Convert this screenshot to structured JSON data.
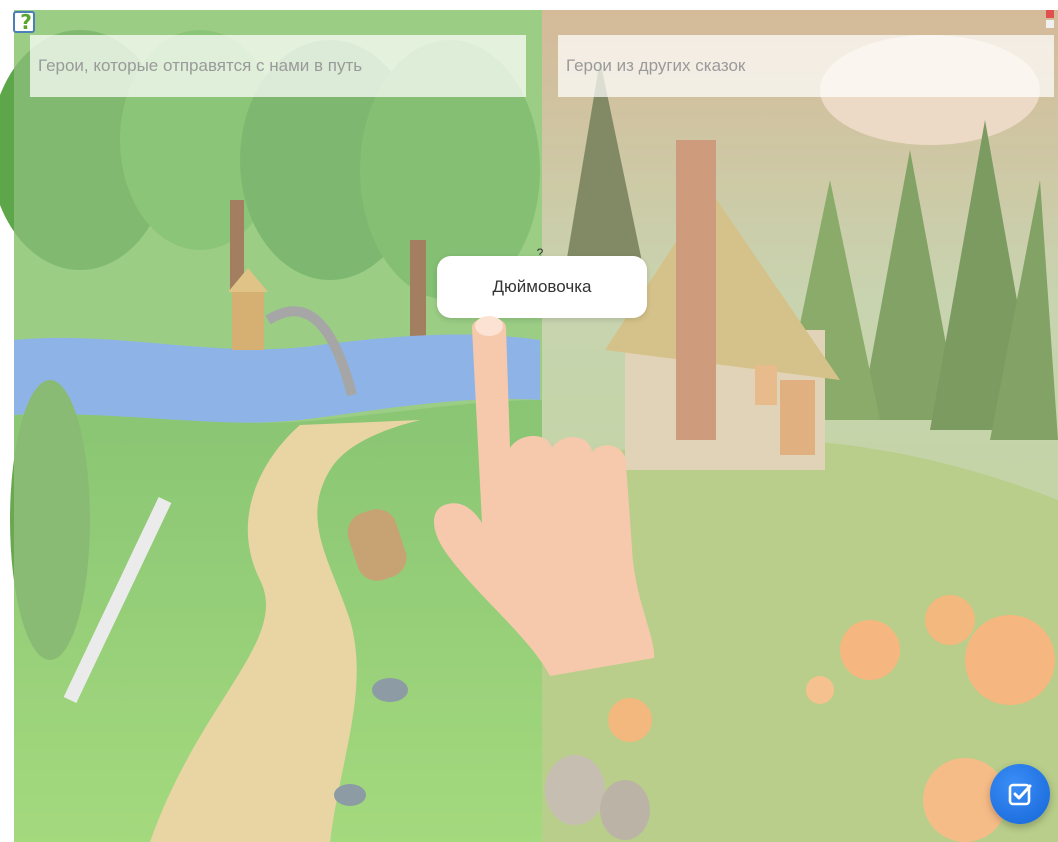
{
  "zones": {
    "left_placeholder": "Герои, которые отправятся с нами в путь",
    "right_placeholder": "Герои из других сказок"
  },
  "card": {
    "label": "Дюймовочка",
    "help_mark": "?"
  },
  "icons": {
    "help": "help-icon",
    "check": "check-icon",
    "hand": "pointing-hand-icon"
  },
  "colors": {
    "check_button": "#1a73e8",
    "hand": "#f6c9ad",
    "forest": "#4caf50",
    "meadow": "#d9c27a"
  }
}
